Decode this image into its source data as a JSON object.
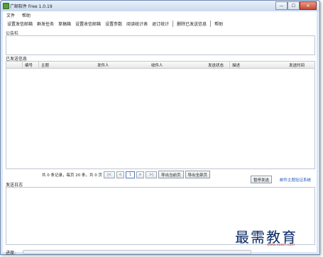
{
  "window": {
    "title": "广邮软件 Free 1.0.19",
    "controls": {
      "minimize": "—",
      "maximize": "☐",
      "close": "✕"
    }
  },
  "menu": {
    "items": [
      "文件",
      "帮助"
    ]
  },
  "toolbar": {
    "items": [
      "设置发信邮箱",
      "群发任务",
      "草稿箱",
      "设置收信邮箱",
      "设置参数",
      "阅读统计表",
      "退订统计",
      "删除已发送信息",
      "帮助"
    ]
  },
  "notice": {
    "label": "公告栏"
  },
  "sent": {
    "label": "已发送信息",
    "columns": [
      "编号",
      "主题",
      "发件人",
      "收件人",
      "发送状态",
      "描述",
      "发送时间"
    ]
  },
  "pager": {
    "summary": "共 0 条记录，每页 20 条，共 0 页",
    "first": "|<",
    "prev": "<",
    "page": "1",
    "next": ">",
    "last": ">|",
    "export_current": "导出当前页",
    "export_all": "导出全部页"
  },
  "log": {
    "label": "发送日志",
    "pause_button": "暂停发送",
    "verify_link": "邮件主题验证系统"
  },
  "status": {
    "progress_label": "进度:",
    "progress": 0
  },
  "watermark": {
    "text": "最需教育",
    "sub": "www.xuexi.com"
  }
}
